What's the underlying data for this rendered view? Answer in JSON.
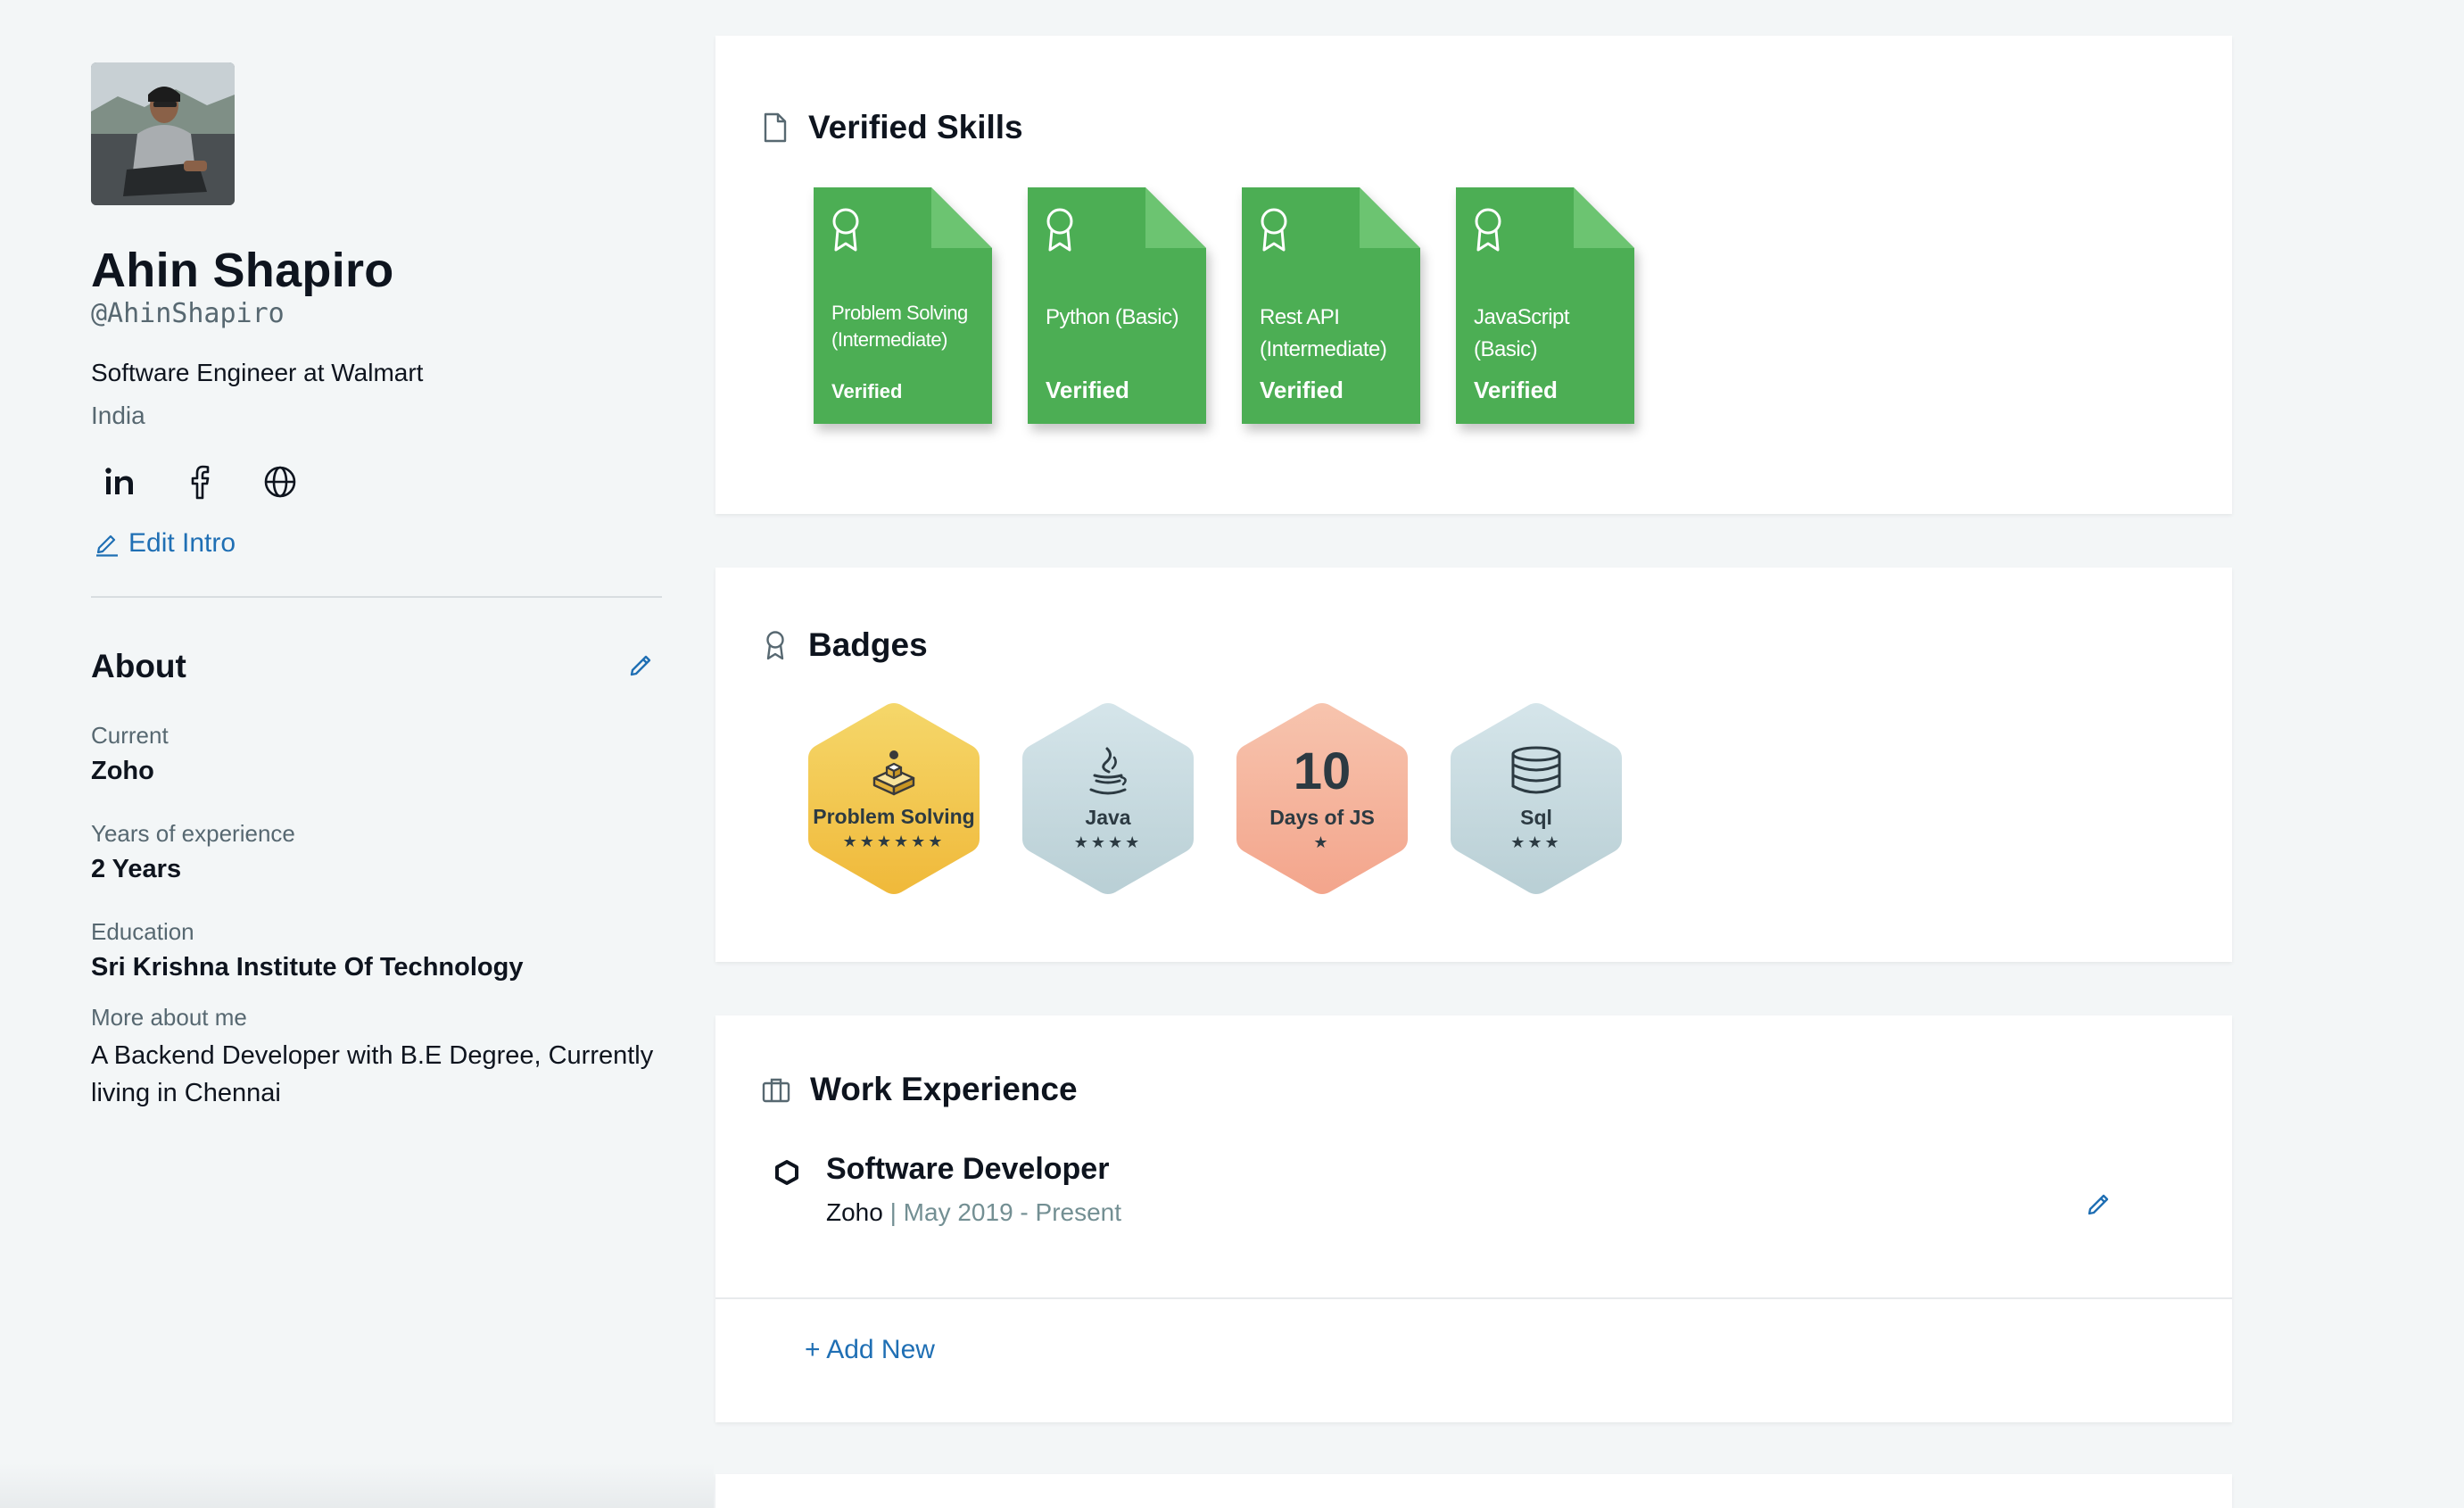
{
  "profile": {
    "name": "Ahin Shapiro",
    "handle": "@AhinShapiro",
    "job": "Software Engineer at Walmart",
    "location": "India",
    "socials": [
      "linkedin-icon",
      "facebook-icon",
      "globe-icon"
    ],
    "edit_intro": "Edit Intro"
  },
  "about": {
    "title": "About",
    "current_label": "Current",
    "current_value": "Zoho",
    "years_label": "Years of experience",
    "years_value": "2 Years",
    "education_label": "Education",
    "education_value": "Sri Krishna Institute Of Technology",
    "more_label": "More about me",
    "more_text": "A Backend Developer with B.E Degree, Currently living in Chennai"
  },
  "skills": {
    "title": "Verified Skills",
    "items": [
      {
        "name": "Problem Solving (Intermediate)",
        "status": "Verified"
      },
      {
        "name": "Python (Basic)",
        "status": "Verified"
      },
      {
        "name": "Rest API (Intermediate)",
        "status": "Verified"
      },
      {
        "name": "JavaScript (Basic)",
        "status": "Verified"
      }
    ]
  },
  "badges": {
    "title": "Badges",
    "items": [
      {
        "name": "Problem Solving",
        "stars": 6,
        "stars_text": "★★★★★★",
        "color": "#f2c94c",
        "icon": "cube-stairs-icon"
      },
      {
        "name": "Java",
        "stars": 4,
        "stars_text": "★★★★",
        "color": "#c9dde2",
        "icon": "java-cup-icon"
      },
      {
        "name": "Days of JS",
        "stars": 1,
        "stars_text": "★",
        "number": "10",
        "color": "#f5b39c",
        "icon": ""
      },
      {
        "name": "Sql",
        "stars": 3,
        "stars_text": "★★★",
        "color": "#c9dde2",
        "icon": "database-icon"
      }
    ]
  },
  "work": {
    "title": "Work Experience",
    "items": [
      {
        "title": "Software Developer",
        "company": "Zoho",
        "separator": "|",
        "dates": "May 2019 - Present"
      }
    ],
    "add_new": "+ Add New"
  },
  "colors": {
    "accent": "#1f6fb4",
    "skill_green": "#4cae54",
    "background": "#f3f6f7"
  }
}
